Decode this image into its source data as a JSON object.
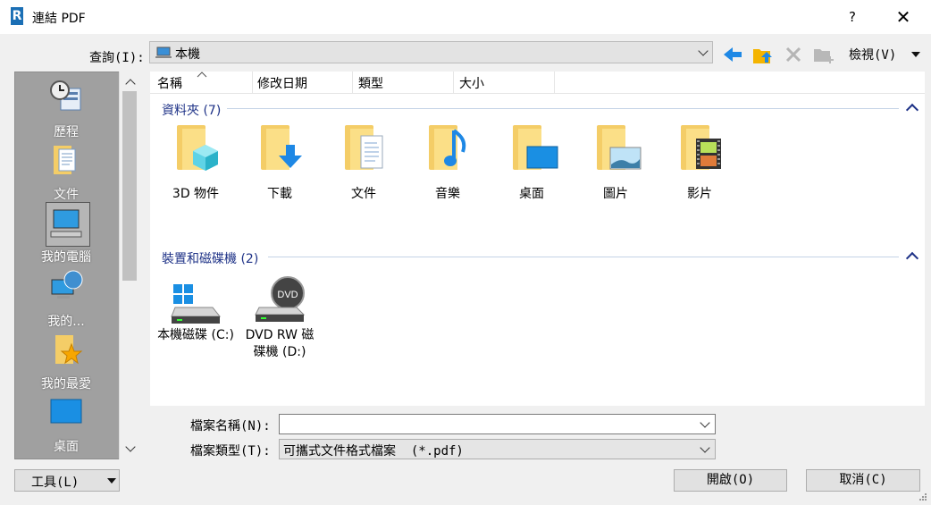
{
  "window": {
    "title": "連結 PDF",
    "app_logo": "R",
    "help": "?",
    "close": "✕"
  },
  "toolbar": {
    "lookin_label": "查詢(I):",
    "lookin_value": "本機",
    "views_label": "檢視(V)"
  },
  "places": [
    {
      "label": "歷程",
      "icon": "history-icon"
    },
    {
      "label": "文件",
      "icon": "documents-icon"
    },
    {
      "label": "我的電腦",
      "icon": "computer-icon",
      "selected": true
    },
    {
      "label": "我的...",
      "icon": "network-icon"
    },
    {
      "label": "我的最愛",
      "icon": "favorites-icon"
    },
    {
      "label": "桌面",
      "icon": "desktop-icon"
    }
  ],
  "columns": [
    "名稱",
    "修改日期",
    "類型",
    "大小"
  ],
  "groups": {
    "folders_title": "資料夾 (7)",
    "drives_title": "裝置和磁碟機 (2)"
  },
  "folders": [
    {
      "label": "3D 物件",
      "icon": "3d-objects-icon"
    },
    {
      "label": "下載",
      "icon": "downloads-icon"
    },
    {
      "label": "文件",
      "icon": "documents-icon"
    },
    {
      "label": "音樂",
      "icon": "music-icon"
    },
    {
      "label": "桌面",
      "icon": "desktop-icon"
    },
    {
      "label": "圖片",
      "icon": "pictures-icon"
    },
    {
      "label": "影片",
      "icon": "videos-icon"
    }
  ],
  "drives": [
    {
      "label": "本機磁碟 (C:)",
      "icon": "local-disk-icon"
    },
    {
      "label": "DVD RW 磁碟機 (D:)",
      "icon": "dvd-drive-icon",
      "badge": "DVD"
    }
  ],
  "bottom": {
    "filename_label": "檔案名稱(N):",
    "filename_value": "",
    "filetype_label": "檔案類型(T):",
    "filetype_value": "可攜式文件格式檔案  (*.pdf)",
    "tools_label": "工具(L)",
    "open_label": "開啟(O)",
    "cancel_label": "取消(C)"
  },
  "colors": {
    "group_title": "#1e3287",
    "places_bg": "#a0a0a0",
    "folder": "#f4cd67",
    "accent_blue": "#1e88e5"
  }
}
